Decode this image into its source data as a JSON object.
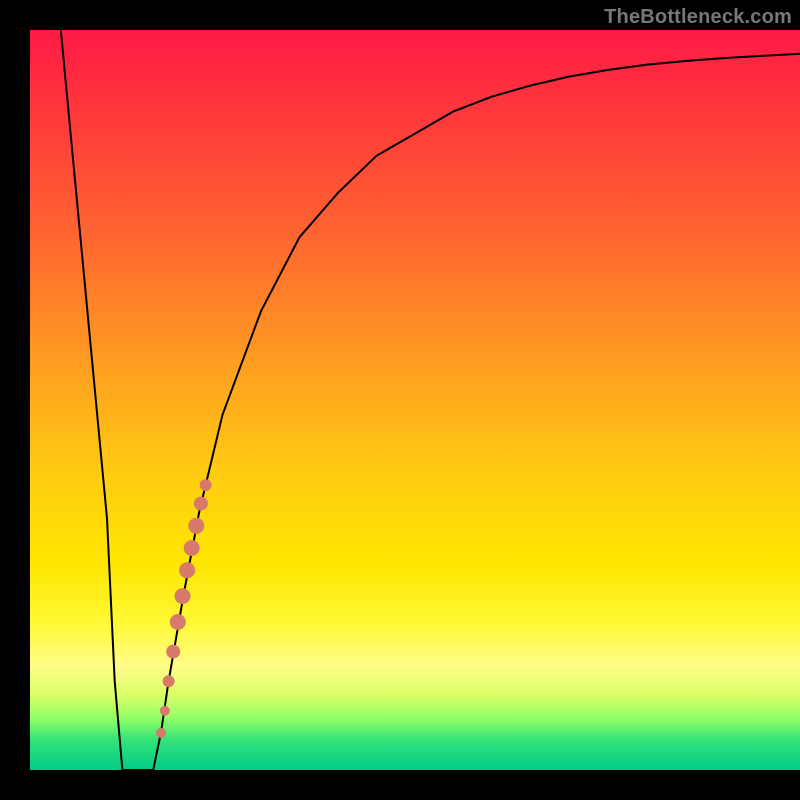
{
  "attribution": "TheBottleneck.com",
  "colors": {
    "marker": "#d87a6a",
    "curve": "#000000"
  },
  "chart_data": {
    "type": "line",
    "title": "",
    "xlabel": "",
    "ylabel": "",
    "xlim": [
      0,
      100
    ],
    "ylim": [
      0,
      100
    ],
    "series": [
      {
        "name": "bottleneck-curve",
        "x": [
          4,
          6,
          8,
          10,
          11,
          12,
          14,
          16,
          17,
          18,
          20,
          22,
          25,
          30,
          35,
          40,
          45,
          50,
          55,
          60,
          65,
          70,
          75,
          80,
          85,
          90,
          95,
          100
        ],
        "y": [
          100,
          78,
          56,
          34,
          12,
          0,
          0,
          0,
          5,
          12,
          24,
          35,
          48,
          62,
          72,
          78,
          83,
          86,
          89,
          91,
          92.5,
          93.7,
          94.6,
          95.3,
          95.8,
          96.2,
          96.5,
          96.8
        ]
      }
    ],
    "markers": {
      "name": "highlighted-points",
      "points": [
        {
          "x": 17.0,
          "y": 5.0,
          "r": 5
        },
        {
          "x": 17.5,
          "y": 8.0,
          "r": 5
        },
        {
          "x": 18.0,
          "y": 12.0,
          "r": 6
        },
        {
          "x": 18.6,
          "y": 16.0,
          "r": 7
        },
        {
          "x": 19.2,
          "y": 20.0,
          "r": 8
        },
        {
          "x": 19.8,
          "y": 23.5,
          "r": 8
        },
        {
          "x": 20.4,
          "y": 27.0,
          "r": 8
        },
        {
          "x": 21.0,
          "y": 30.0,
          "r": 8
        },
        {
          "x": 21.6,
          "y": 33.0,
          "r": 8
        },
        {
          "x": 22.2,
          "y": 36.0,
          "r": 7
        },
        {
          "x": 22.8,
          "y": 38.5,
          "r": 6
        }
      ]
    }
  }
}
